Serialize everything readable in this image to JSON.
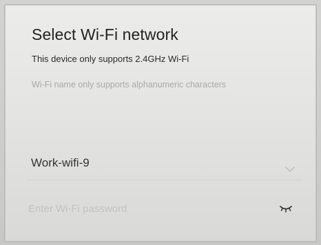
{
  "dialog": {
    "title": "Select Wi-Fi network",
    "notice": "This device only supports 2.4GHz Wi-Fi",
    "hint": "Wi-Fi name only supports alphanumeric characters"
  },
  "network": {
    "selected": "Work-wifi-9",
    "icon": "chevron-down-icon"
  },
  "password": {
    "value": "",
    "placeholder": "Enter Wi-Fi password",
    "icon": "eye-closed-icon"
  }
}
